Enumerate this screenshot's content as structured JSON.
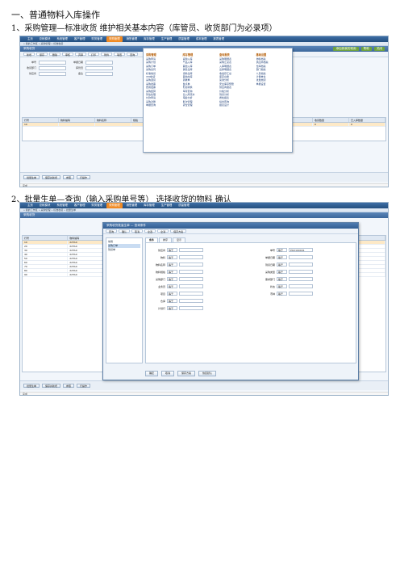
{
  "headings": {
    "section_title": "一、普通物料入库操作",
    "step1": "1、采购管理—标准收货   维护相关基本内容（库管员、收货部门为必录项）",
    "step2": "2、批量生单—查询（输入采购单号等）    选择收货的物料      确认"
  },
  "shot1": {
    "top_menu": [
      "主页",
      "总帐模块",
      "系统管理",
      "客户管理",
      "财务管理",
      "采购管理",
      "销售管理",
      "库存管理",
      "生产管理",
      "质量管理",
      "成本管理",
      "报表管理"
    ],
    "breadcrumb": "» 我的工作区 » 采购管理 » 标准收货",
    "window_title": "采购收货",
    "title_actions": [
      "添加到我的常用",
      "帮助",
      "关闭"
    ],
    "toolbar": [
      "新增",
      "保存",
      "删除",
      "审核",
      "弃审",
      "打印",
      "附件",
      "联查",
      "查询"
    ],
    "form_labels": [
      "单号",
      "单据日期",
      "收货部门",
      "库管员",
      "供应商",
      "备注"
    ],
    "grid_headers": [
      "行号",
      "物料编码",
      "物料名称",
      "规格",
      "单位",
      "数量",
      "单价",
      "金额",
      "收货数量",
      "已入库数量"
    ],
    "grid_rows": [
      [
        "10",
        "",
        "",
        "",
        "",
        "0",
        "0",
        "0",
        "0",
        "0"
      ]
    ],
    "bottom_buttons": [
      "批量生单",
      "保存并新增",
      "参照",
      "行操作"
    ],
    "status": "完成",
    "mega_menu": [
      {
        "title": "采购管理",
        "items": [
          "采购申请",
          "采购计划",
          "采购订单",
          "采购合同",
          "标准收货",
          "VMI收货",
          "采购退货",
          "采购发票",
          "费用发票",
          "采购结算",
          "暂估处理",
          "付款申请",
          "采购对账",
          "单据查询"
        ]
      },
      {
        "title": "库存管理",
        "items": [
          "采购入库",
          "产品入库",
          "其他入库",
          "销售出库",
          "领料出库",
          "其他出库",
          "调拨单",
          "盘点单",
          "形态转换",
          "库存查询",
          "出入库流水",
          "库龄分析",
          "批次管理",
          "货位管理"
        ]
      },
      {
        "title": "查询报表",
        "items": [
          "采购明细表",
          "采购汇总表",
          "入库明细表",
          "出库明细表",
          "收发存汇总",
          "库存台账",
          "呆滞分析",
          "安全库存预警",
          "供应商报表",
          "价格分析",
          "到货分析",
          "质检报表",
          "综合查询",
          "报表设计"
        ]
      },
      {
        "title": "基础设置",
        "items": [
          "物料档案",
          "供应商档案",
          "仓库档案",
          "部门档案",
          "人员档案",
          "计量单位",
          "收发类别",
          "单据设置"
        ]
      }
    ]
  },
  "shot2": {
    "top_menu": [
      "主页",
      "总帐模块",
      "系统管理",
      "客户管理",
      "财务管理",
      "采购管理",
      "销售管理",
      "库存管理",
      "生产管理",
      "质量管理"
    ],
    "breadcrumb": "» 我的工作区 » 采购管理 » 标准收货 » 批量生单",
    "window_title": "采购收货",
    "grid_headers": [
      "行号",
      "物料编码",
      "物料名称",
      "规格",
      "单位",
      "数量",
      "单价",
      "金额"
    ],
    "grid_rows": [
      [
        "10",
        "22TA0",
        "",
        "",
        "",
        "",
        "",
        "0.0000"
      ],
      [
        "20",
        "22TA0",
        "",
        "",
        "",
        "",
        "",
        "0.0000"
      ],
      [
        "30",
        "22TA0",
        "",
        "",
        "",
        "",
        "",
        "0.0000"
      ],
      [
        "40",
        "22TA0",
        "",
        "",
        "",
        "",
        "",
        "0.0000"
      ],
      [
        "50",
        "22TA0",
        "",
        "",
        "",
        "",
        "",
        "0.0000"
      ],
      [
        "60",
        "22TA0",
        "",
        "",
        "",
        "",
        "",
        "0.0000"
      ],
      [
        "70",
        "22TA0",
        "",
        "",
        "",
        "",
        "",
        "0.0000"
      ],
      [
        "80",
        "22TA0",
        "",
        "",
        "",
        "",
        "",
        "0.0000"
      ],
      [
        "90",
        "22TA0",
        "",
        "",
        "",
        "",
        "",
        "0.0000"
      ]
    ],
    "bottom_buttons": [
      "批量生单",
      "保存并新增",
      "参照",
      "行操作"
    ],
    "status": "完成",
    "dialog": {
      "title": "采购收货批量生单 — 查询条件",
      "toolbar": [
        "查询",
        "确认",
        "取消",
        "全选",
        "全消",
        "保存方案"
      ],
      "tree": [
        "常用",
        "采购订单",
        "到货单"
      ],
      "tabs": [
        "条件",
        "排序",
        "显示"
      ],
      "conditions_left": [
        "供应商",
        "物料",
        "物料名称",
        "物料规格",
        "采购部门",
        "业务员",
        "项目",
        "仓库",
        "计划行"
      ],
      "conditions_right": [
        "单号",
        "单据日期",
        "到货日期",
        "采购类型",
        "需求部门",
        "状态",
        "币种"
      ],
      "operator": "等于",
      "order_no_value": "PO2100001",
      "buttons": [
        "确定",
        "取消",
        "保存方案",
        "恢复默认"
      ]
    }
  }
}
